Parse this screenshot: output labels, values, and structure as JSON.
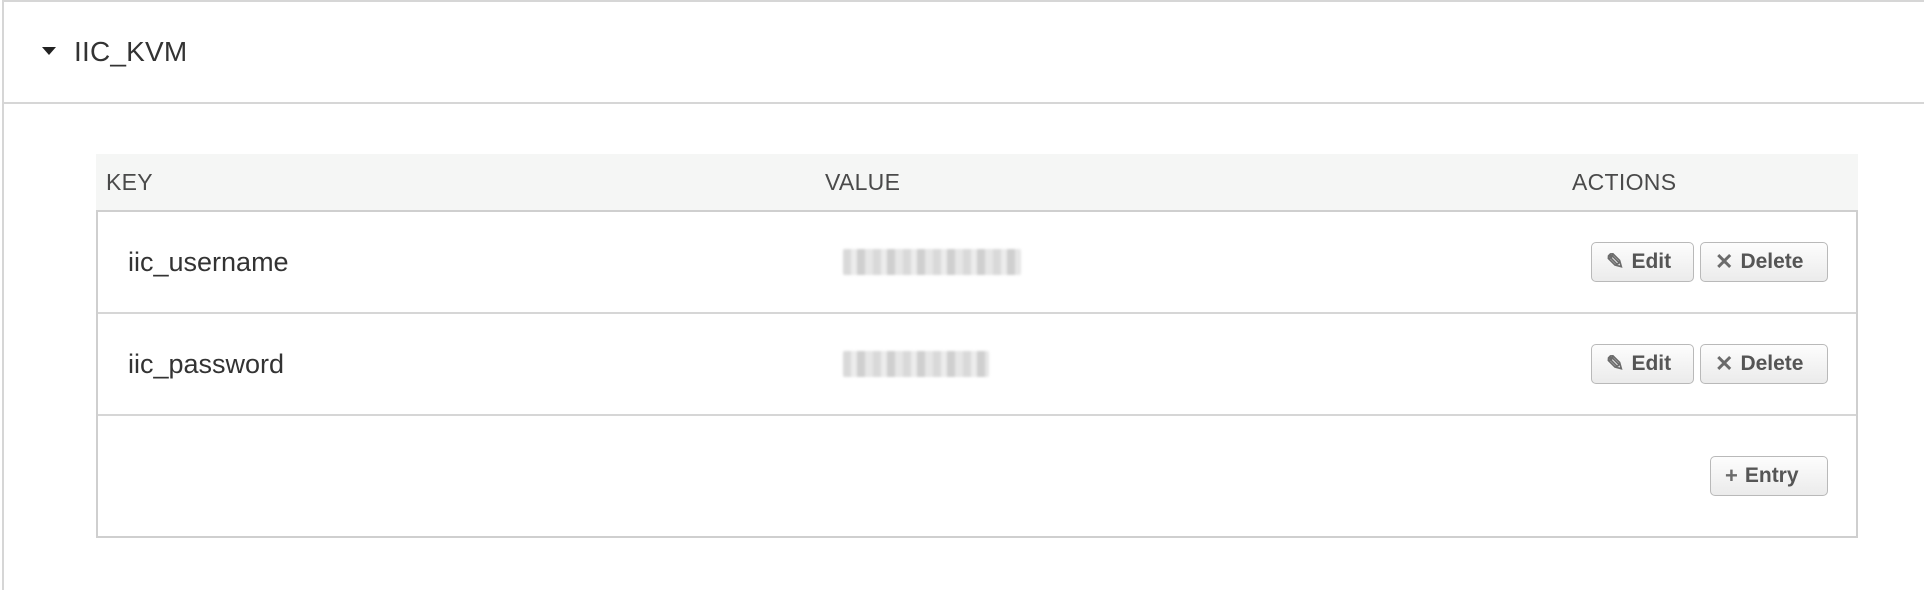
{
  "section": {
    "title": "IIC_KVM",
    "caret_icon": "caret-down-icon"
  },
  "table": {
    "headers": {
      "key": "KEY",
      "value": "VALUE",
      "actions": "ACTIONS"
    },
    "rows": [
      {
        "key": "iic_username",
        "value": "••••••••••••"
      },
      {
        "key": "iic_password",
        "value": "•••••••••"
      }
    ],
    "actions": {
      "edit_label": "Edit",
      "edit_icon": "pencil-icon",
      "delete_label": "Delete",
      "delete_icon": "x-icon"
    },
    "add_entry": {
      "label": "Entry",
      "icon": "plus-icon"
    }
  },
  "colors": {
    "border": "#d6d6d6",
    "header_bg": "#f5f6f5",
    "text": "#333333",
    "button_text": "#555555"
  }
}
